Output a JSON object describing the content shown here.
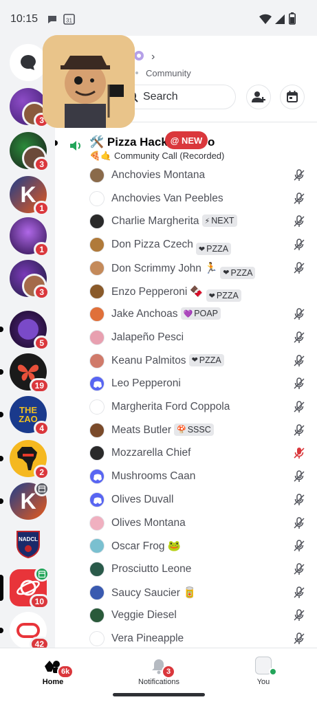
{
  "status_bar": {
    "time": "10:15",
    "calendar_day": "31"
  },
  "servers": [
    {
      "badge": "3"
    },
    {
      "badge": "3"
    },
    {
      "badge": "1"
    },
    {
      "badge": "1"
    },
    {
      "badge": "3"
    },
    {
      "badge": "5"
    },
    {
      "badge": "19"
    },
    {
      "badge": "4"
    },
    {
      "badge": "2"
    },
    {
      "badge": ""
    },
    {
      "badge": ""
    },
    {
      "badge": "10"
    },
    {
      "badge": "42"
    }
  ],
  "server_logos": {
    "zao": "THE ZAO",
    "nadcl": "NADCL",
    "k": "K"
  },
  "header": {
    "chevron": "›",
    "server_subtitle": "Community",
    "search_label": "Search"
  },
  "channel": {
    "name": "🛠️ Pizza Hack",
    "name_tail": "o",
    "subtitle": "🍕🤙 Community Call (Recorded)",
    "new_badge": "@ NEW"
  },
  "members": [
    {
      "name": "Anchovies Montana",
      "tag": "",
      "tag_icon": "",
      "extra": "",
      "mic": "muted"
    },
    {
      "name": "Anchovies Van Peebles",
      "tag": "",
      "tag_icon": "",
      "extra": "",
      "mic": "muted"
    },
    {
      "name": "Charlie Margherita",
      "tag": "NEXT",
      "tag_icon": "⚡",
      "extra": "",
      "mic": "muted"
    },
    {
      "name": "Don Pizza Czech",
      "tag": "PZZA",
      "tag_icon": "❤",
      "extra": "",
      "mic": "muted"
    },
    {
      "name": "Don Scrimmy John",
      "tag": "PZZA",
      "tag_icon": "❤",
      "extra": "🏃",
      "mic": "muted"
    },
    {
      "name": "Enzo Pepperoni",
      "tag": "PZZA",
      "tag_icon": "❤",
      "extra": "🍫",
      "mic": "none"
    },
    {
      "name": "Jake Anchoas",
      "tag": "POAP",
      "tag_icon": "💜",
      "extra": "",
      "mic": "muted"
    },
    {
      "name": "Jalapeño Pesci",
      "tag": "",
      "tag_icon": "",
      "extra": "",
      "mic": "muted"
    },
    {
      "name": "Keanu Palmitos",
      "tag": "PZZA",
      "tag_icon": "❤",
      "extra": "",
      "mic": "muted"
    },
    {
      "name": "Leo Pepperoni",
      "tag": "",
      "tag_icon": "",
      "extra": "",
      "mic": "muted"
    },
    {
      "name": "Margherita Ford Coppola",
      "tag": "",
      "tag_icon": "",
      "extra": "",
      "mic": "muted"
    },
    {
      "name": "Meats Butler",
      "tag": "SSSC",
      "tag_icon": "🍄",
      "extra": "",
      "mic": "muted"
    },
    {
      "name": "Mozzarella Chief",
      "tag": "",
      "tag_icon": "",
      "extra": "",
      "mic": "server-muted"
    },
    {
      "name": "Mushrooms Caan",
      "tag": "",
      "tag_icon": "",
      "extra": "",
      "mic": "muted"
    },
    {
      "name": "Olives Duvall",
      "tag": "",
      "tag_icon": "",
      "extra": "",
      "mic": "muted"
    },
    {
      "name": "Olives Montana",
      "tag": "",
      "tag_icon": "",
      "extra": "",
      "mic": "muted"
    },
    {
      "name": "Oscar Frog",
      "tag": "",
      "tag_icon": "",
      "extra": "🐸",
      "mic": "muted"
    },
    {
      "name": "Prosciutto Leone",
      "tag": "",
      "tag_icon": "",
      "extra": "",
      "mic": "muted"
    },
    {
      "name": "Saucy Saucier",
      "tag": "",
      "tag_icon": "",
      "extra": "🥫",
      "mic": "muted"
    },
    {
      "name": "Veggie Diesel",
      "tag": "",
      "tag_icon": "",
      "extra": "",
      "mic": "muted"
    },
    {
      "name": "Vera Pineapple",
      "tag": "",
      "tag_icon": "",
      "extra": "",
      "mic": "muted"
    }
  ],
  "bottom_nav": {
    "home": {
      "label": "Home",
      "badge": "6k"
    },
    "notifications": {
      "label": "Notifications",
      "badge": "3"
    },
    "you": {
      "label": "You"
    }
  },
  "colors": {
    "accent_red": "#da373c",
    "blurple": "#5865f2",
    "voice_green": "#23a55a",
    "server_mute_red": "#da373c"
  }
}
